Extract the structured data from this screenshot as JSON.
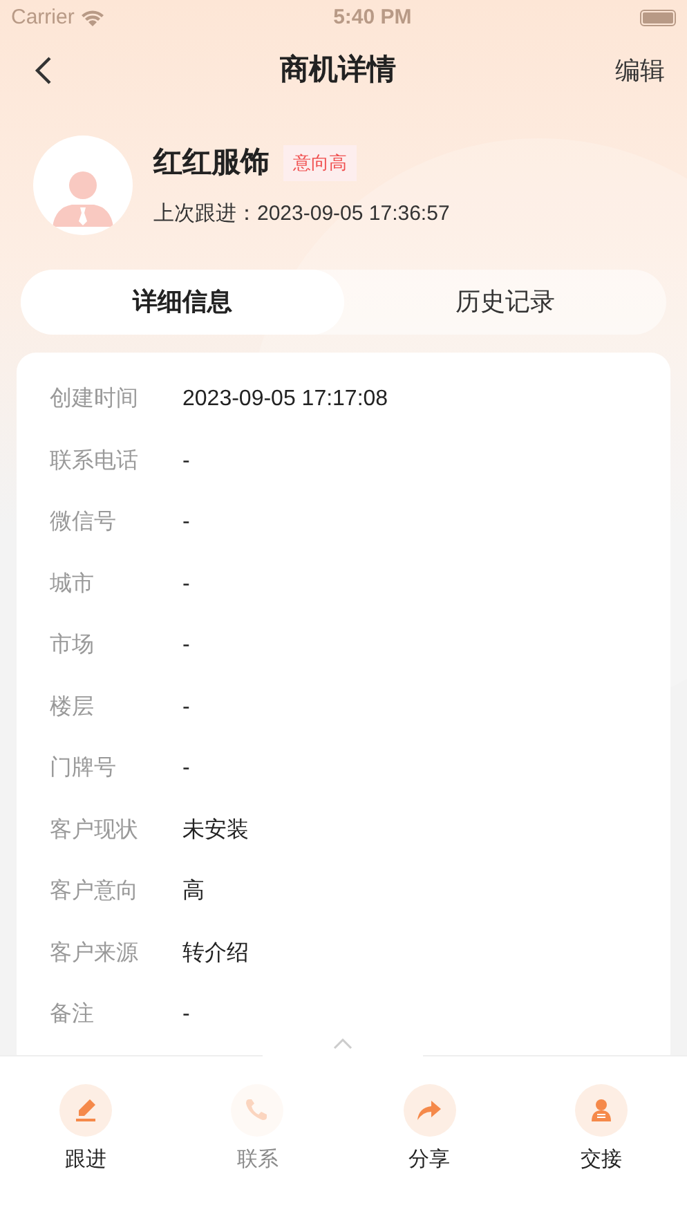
{
  "status_bar": {
    "carrier": "Carrier",
    "time": "5:40 PM"
  },
  "nav": {
    "title": "商机详情",
    "action": "编辑"
  },
  "customer": {
    "name": "红红服饰",
    "tag": "意向高",
    "last_follow": "上次跟进：2023-09-05 17:36:57"
  },
  "tabs": [
    {
      "label": "详细信息",
      "selected": true
    },
    {
      "label": "历史记录",
      "selected": false
    }
  ],
  "fields": [
    {
      "label": "创建时间",
      "value": "2023-09-05 17:17:08"
    },
    {
      "label": "联系电话",
      "value": "-"
    },
    {
      "label": "微信号",
      "value": "-"
    },
    {
      "label": "城市",
      "value": "-"
    },
    {
      "label": "市场",
      "value": "-"
    },
    {
      "label": "楼层",
      "value": "-"
    },
    {
      "label": "门牌号",
      "value": "-"
    },
    {
      "label": "客户现状",
      "value": "未安装"
    },
    {
      "label": "客户意向",
      "value": "高"
    },
    {
      "label": "客户来源",
      "value": "转介绍"
    },
    {
      "label": "备注",
      "value": "-"
    }
  ],
  "actions": [
    {
      "label": "跟进",
      "disabled": false
    },
    {
      "label": "联系",
      "disabled": true
    },
    {
      "label": "分享",
      "disabled": false
    },
    {
      "label": "交接",
      "disabled": false
    }
  ]
}
